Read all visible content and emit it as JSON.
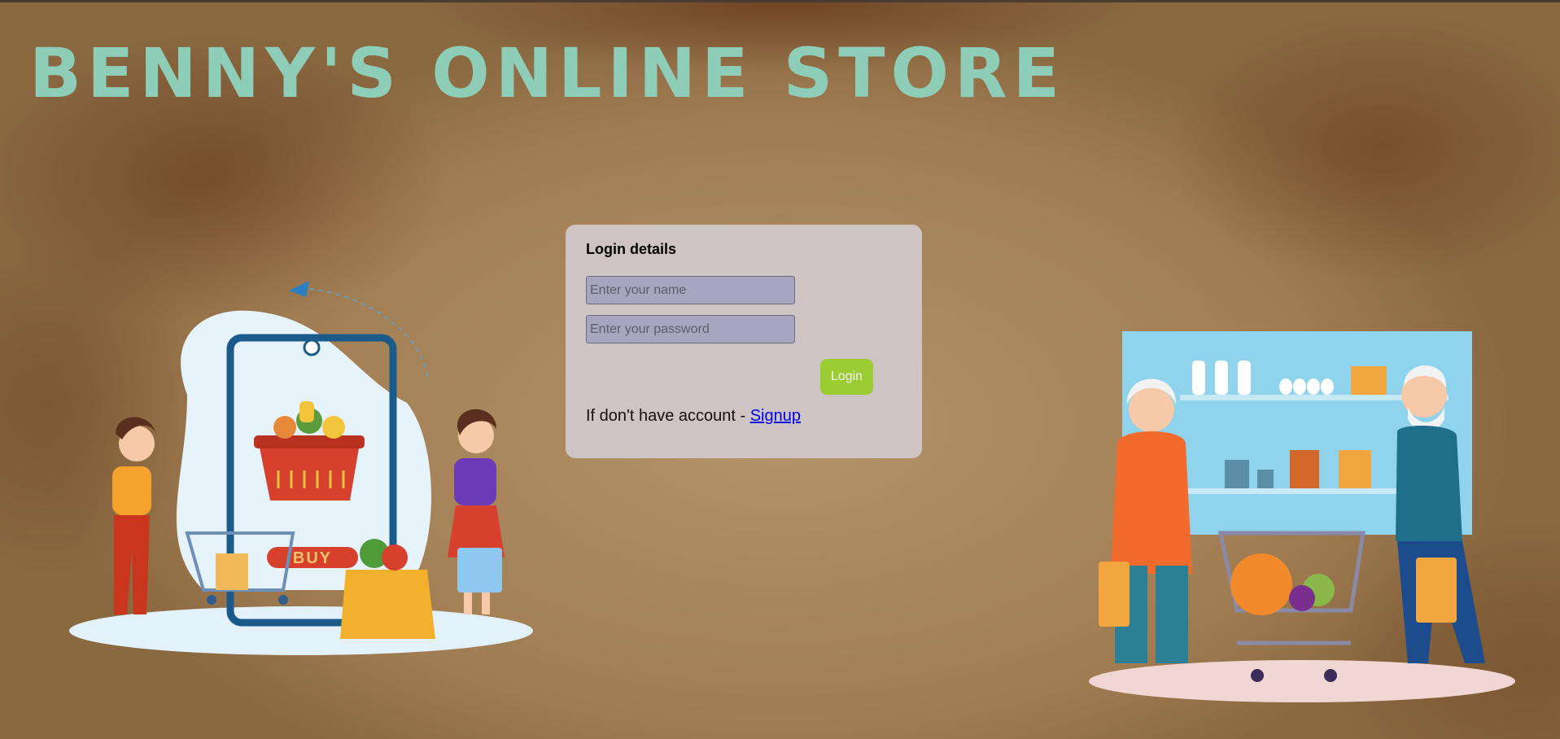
{
  "header": {
    "title": "BENNY'S ONLINE STORE"
  },
  "login": {
    "heading": "Login details",
    "name_placeholder": "Enter your name",
    "password_placeholder": "Enter your password",
    "login_label": "Login",
    "signup_prompt": "If don't have account - ",
    "signup_link": "Signup"
  },
  "illustrations": {
    "left_button_label": "BUY"
  },
  "colors": {
    "title": "#8ecdb8",
    "card_background": "#cfc4c4",
    "login_button": "#9acd32",
    "input_background": "#a7a5c0"
  }
}
